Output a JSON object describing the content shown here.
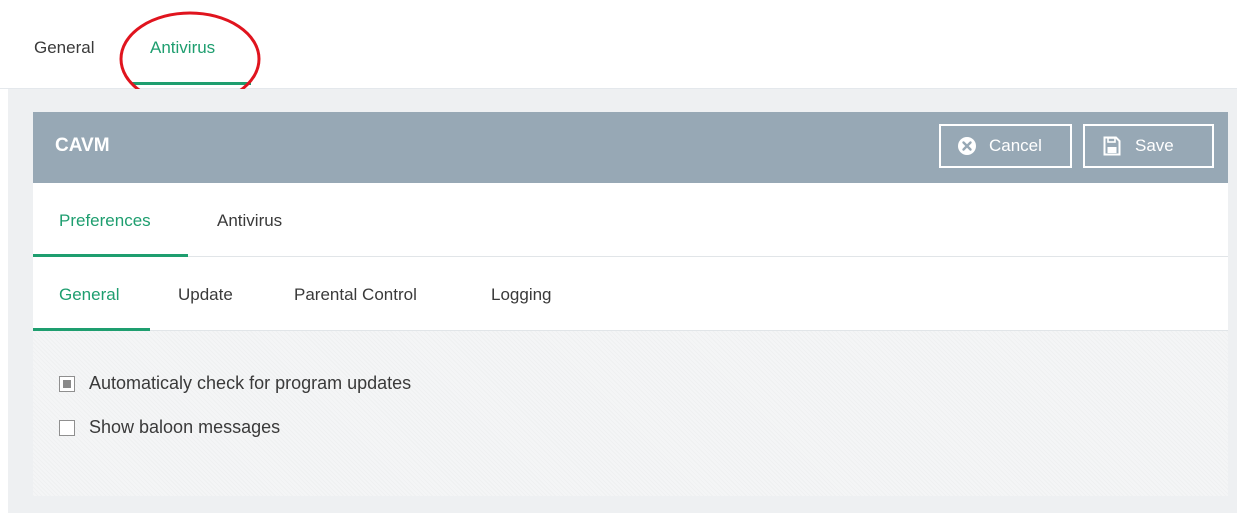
{
  "top_tabs": [
    {
      "label": "General",
      "active": false
    },
    {
      "label": "Antivirus",
      "active": true
    }
  ],
  "panel": {
    "title": "CAVM",
    "cancel_label": "Cancel",
    "save_label": "Save"
  },
  "tabs_level1": [
    {
      "label": "Preferences",
      "active": true
    },
    {
      "label": "Antivirus",
      "active": false
    }
  ],
  "tabs_level2": [
    {
      "label": "General",
      "active": true
    },
    {
      "label": "Update",
      "active": false
    },
    {
      "label": "Parental Control",
      "active": false
    },
    {
      "label": "Logging",
      "active": false
    }
  ],
  "options": [
    {
      "label": "Automaticaly check for program updates",
      "checked": true
    },
    {
      "label": "Show baloon messages",
      "checked": false
    }
  ],
  "colors": {
    "accent": "#1e9e6f",
    "header_bg": "#97a8b5",
    "annotation": "#e0141e"
  },
  "icons": {
    "cancel": "x-circle-icon",
    "save": "floppy-disk-icon"
  }
}
